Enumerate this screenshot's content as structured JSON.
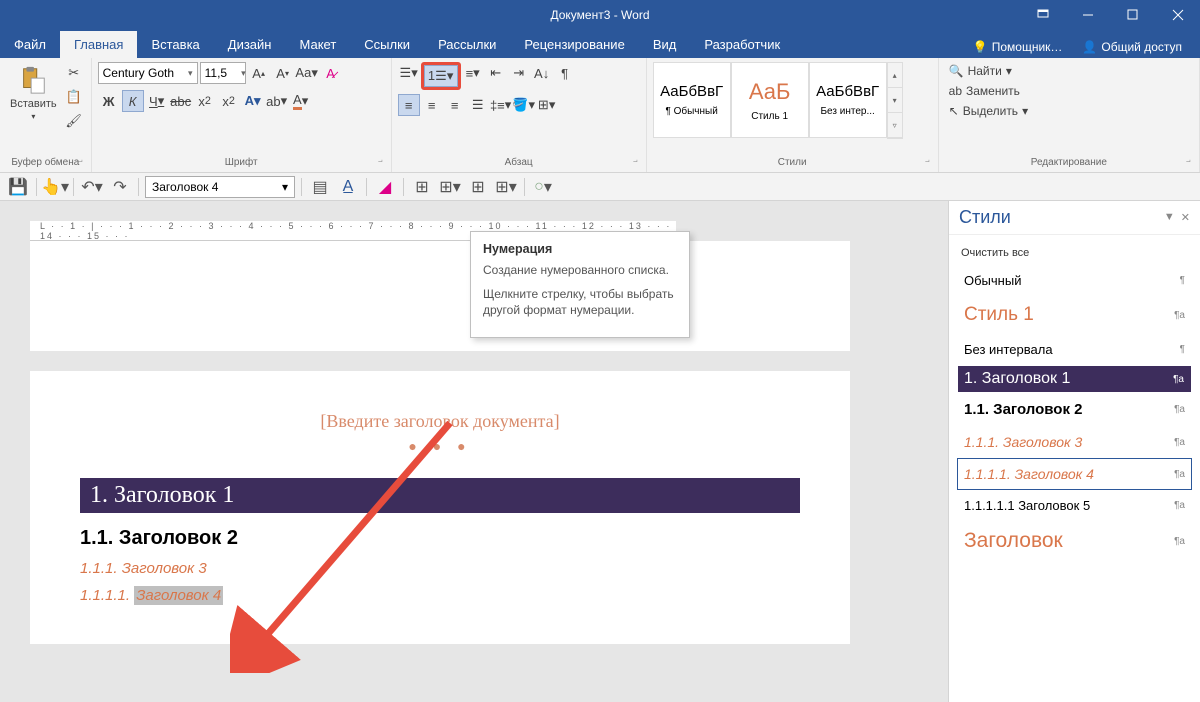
{
  "titlebar": {
    "title": "Документ3 - Word"
  },
  "tabs": [
    "Файл",
    "Главная",
    "Вставка",
    "Дизайн",
    "Макет",
    "Ссылки",
    "Рассылки",
    "Рецензирование",
    "Вид",
    "Разработчик"
  ],
  "active_tab_index": 1,
  "help_label": "Помощник…",
  "share_label": "Общий доступ",
  "clipboard": {
    "paste": "Вставить",
    "group": "Буфер обмена"
  },
  "font": {
    "name": "Century Goth",
    "size": "11,5",
    "group": "Шрифт",
    "bold": "Ж",
    "italic": "К",
    "underline": "Ч",
    "strike": "abc"
  },
  "para": {
    "group": "Абзац"
  },
  "styles": {
    "group": "Стили",
    "sample_text": "АаБбВвГ",
    "sample_text_big": "АаБ",
    "items": [
      {
        "label": "¶ Обычный"
      },
      {
        "label": "Стиль 1"
      },
      {
        "label": "Без интер..."
      }
    ]
  },
  "editing": {
    "group": "Редактирование",
    "find": "Найти",
    "replace": "Заменить",
    "select": "Выделить"
  },
  "qat": {
    "style": "Заголовок 4"
  },
  "ruler_text": "L · · 1 · | · · · 1 · · · 2 · · · 3 · · · 4 · · · 5 · · · 6 · · · 7 · · · 8 · · · 9 · · · 10 · · · 11 · · · 12 · · · 13 · · · 14 · · · 15 · · ·",
  "tooltip": {
    "title": "Нумерация",
    "p1": "Создание нумерованного списка.",
    "p2": "Щелкните стрелку, чтобы выбрать другой формат нумерации."
  },
  "document": {
    "placeholder": "[Введите заголовок документа]",
    "h1": "1.  Заголовок 1",
    "h2": "1.1.  Заголовок 2",
    "h3": "1.1.1.  Заголовок 3",
    "h4_num": "1.1.1.1.  ",
    "h4_text": "Заголовок 4"
  },
  "styles_pane": {
    "title": "Стили",
    "clear": "Очистить все",
    "items": [
      {
        "key": "normal",
        "label": "Обычный",
        "mark": "¶"
      },
      {
        "key": "s1",
        "label": "Стиль 1",
        "mark": "¶a"
      },
      {
        "key": "noint",
        "label": "Без интервала",
        "mark": "¶"
      },
      {
        "key": "h1",
        "label": "1.  Заголовок 1",
        "mark": "¶a"
      },
      {
        "key": "h2",
        "label": "1.1.  Заголовок 2",
        "mark": "¶a"
      },
      {
        "key": "h3",
        "label": "1.1.1.  Заголовок 3",
        "mark": "¶a"
      },
      {
        "key": "h4",
        "label": "1.1.1.1.  Заголовок 4",
        "mark": "¶a"
      },
      {
        "key": "h5",
        "label": "1.1.1.1.1  Заголовок 5",
        "mark": "¶a"
      },
      {
        "key": "title",
        "label": "Заголовок",
        "mark": "¶a"
      }
    ]
  }
}
